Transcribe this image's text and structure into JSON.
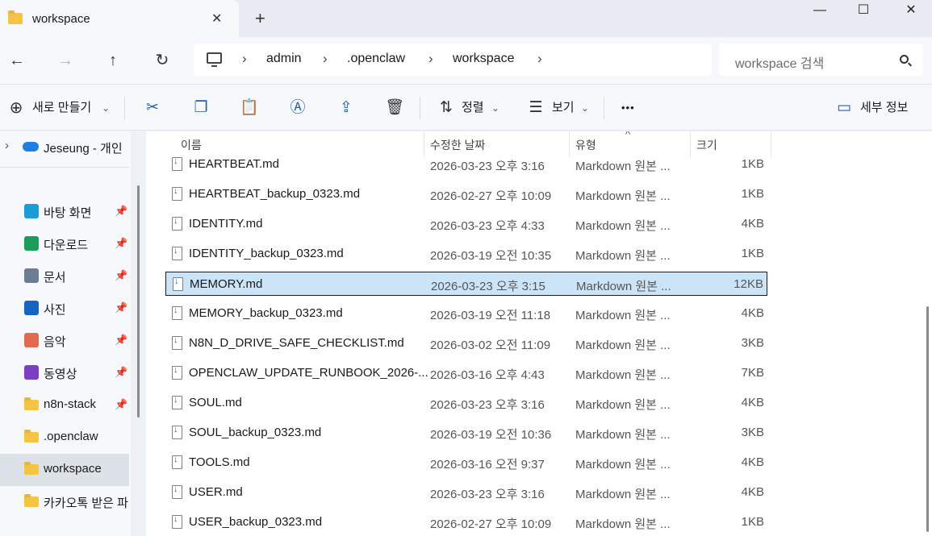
{
  "window": {
    "tab_title": "workspace",
    "close_tab": "✕",
    "new_tab": "+",
    "minimize": "—",
    "maximize": "☐",
    "close": "✕"
  },
  "nav": {
    "back": "←",
    "forward": "→",
    "up": "↑",
    "refresh": "↻",
    "breadcrumbs": [
      "admin",
      ".openclaw",
      "workspace"
    ],
    "separator": "›",
    "search_placeholder": "workspace 검색"
  },
  "toolbar": {
    "new_label": "새로 만들기",
    "sort_label": "정렬",
    "view_label": "보기",
    "more": "•••",
    "details_label": "세부 정보",
    "caret": "⌄"
  },
  "sidebar": {
    "cloud_item": "Jeseung - 개인",
    "quick_access": [
      {
        "label": "바탕 화면",
        "icon": "desktop-icon",
        "color": "#1b9bd8",
        "pinned": true
      },
      {
        "label": "다운로드",
        "icon": "download-icon",
        "color": "#1a9c5b",
        "pinned": true
      },
      {
        "label": "문서",
        "icon": "document-icon",
        "color": "#6b7c93",
        "pinned": true
      },
      {
        "label": "사진",
        "icon": "pictures-icon",
        "color": "#1565c0",
        "pinned": true
      },
      {
        "label": "음악",
        "icon": "music-icon",
        "color": "#e26a4f",
        "pinned": true
      },
      {
        "label": "동영상",
        "icon": "video-icon",
        "color": "#7b3fc4",
        "pinned": true
      },
      {
        "label": "n8n-stack",
        "icon": "folder-icon",
        "color": "#f4c542",
        "pinned": true
      },
      {
        "label": ".openclaw",
        "icon": "folder-icon",
        "color": "#f4c542",
        "pinned": false
      },
      {
        "label": "workspace",
        "icon": "folder-icon",
        "color": "#f4c542",
        "pinned": false,
        "active": true
      },
      {
        "label": "카카오톡 받은 파",
        "icon": "folder-icon",
        "color": "#f4c542",
        "pinned": false
      }
    ],
    "pin_glyph": "📌",
    "expand_glyph": "›"
  },
  "columns": {
    "name": "이름",
    "date": "수정한 날짜",
    "type": "유형",
    "size": "크기",
    "sort_glyph": "^"
  },
  "files": [
    {
      "name": "HEARTBEAT.md",
      "date": "2026-03-23 오후 3:16",
      "type": "Markdown 원본 ...",
      "size": "1KB"
    },
    {
      "name": "HEARTBEAT_backup_0323.md",
      "date": "2026-02-27 오후 10:09",
      "type": "Markdown 원본 ...",
      "size": "1KB"
    },
    {
      "name": "IDENTITY.md",
      "date": "2026-03-23 오후 4:33",
      "type": "Markdown 원본 ...",
      "size": "4KB"
    },
    {
      "name": "IDENTITY_backup_0323.md",
      "date": "2026-03-19 오전 10:35",
      "type": "Markdown 원본 ...",
      "size": "1KB"
    },
    {
      "name": "MEMORY.md",
      "date": "2026-03-23 오후 3:15",
      "type": "Markdown 원본 ...",
      "size": "12KB",
      "selected": true
    },
    {
      "name": "MEMORY_backup_0323.md",
      "date": "2026-03-19 오전 11:18",
      "type": "Markdown 원본 ...",
      "size": "4KB"
    },
    {
      "name": "N8N_D_DRIVE_SAFE_CHECKLIST.md",
      "date": "2026-03-02 오전 11:09",
      "type": "Markdown 원본 ...",
      "size": "3KB"
    },
    {
      "name": "OPENCLAW_UPDATE_RUNBOOK_2026-...",
      "date": "2026-03-16 오후 4:43",
      "type": "Markdown 원본 ...",
      "size": "7KB"
    },
    {
      "name": "SOUL.md",
      "date": "2026-03-23 오후 3:16",
      "type": "Markdown 원본 ...",
      "size": "4KB"
    },
    {
      "name": "SOUL_backup_0323.md",
      "date": "2026-03-19 오전 10:36",
      "type": "Markdown 원본 ...",
      "size": "3KB"
    },
    {
      "name": "TOOLS.md",
      "date": "2026-03-16 오전 9:37",
      "type": "Markdown 원본 ...",
      "size": "4KB"
    },
    {
      "name": "USER.md",
      "date": "2026-03-23 오후 3:16",
      "type": "Markdown 원본 ...",
      "size": "4KB"
    },
    {
      "name": "USER_backup_0323.md",
      "date": "2026-02-27 오후 10:09",
      "type": "Markdown 원본 ...",
      "size": "1KB"
    }
  ]
}
